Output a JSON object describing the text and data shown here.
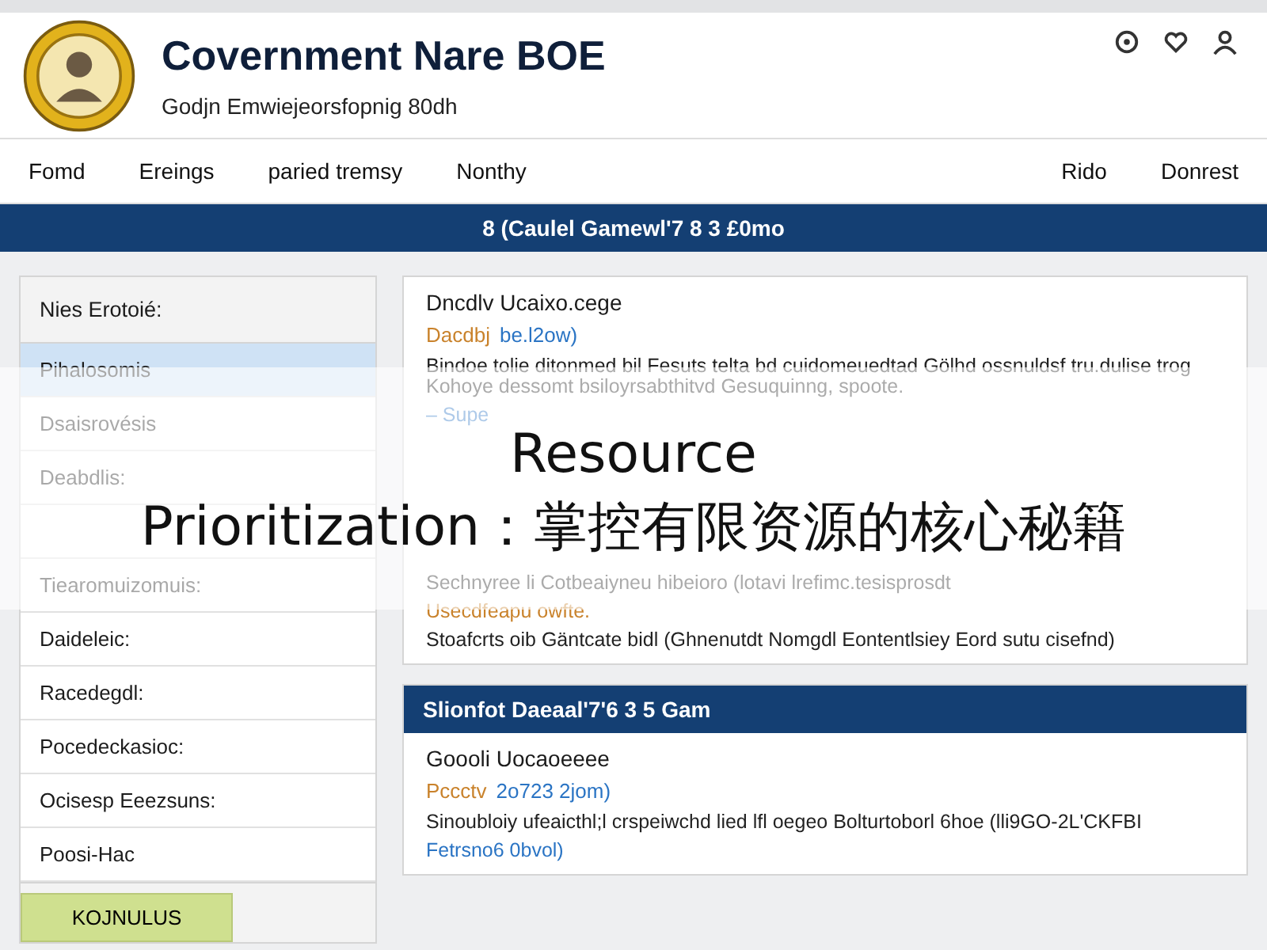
{
  "header": {
    "title": "Covernment Nare BOE",
    "subtitle": "Godjn Emwiejeorsfopnig 80dh"
  },
  "nav": {
    "left": [
      "Fomd",
      "Ereings",
      "paried tremsy",
      "Nonthy"
    ],
    "right": [
      "Rido",
      "Donrest"
    ]
  },
  "banner": "8 (Caulel Gamewl'7 8 3 £0mo",
  "sidebar": {
    "heading": "Nies Erotoié:",
    "items": [
      {
        "label": "Pihalosomis",
        "selected": true
      },
      {
        "label": "Dsaisrovésis",
        "selected": false
      },
      {
        "label": "Deabdlis:",
        "selected": false
      },
      {
        "selected": false
      },
      {
        "label": "Tiearomuizomuis:",
        "selected": false
      },
      {
        "label": "Daideleic:",
        "selected": false
      },
      {
        "label": "Racedegdl:",
        "selected": false
      },
      {
        "label": "Pocedeckasioc:",
        "selected": false
      },
      {
        "label": "Ocisesp Eeezsuns:",
        "selected": false
      },
      {
        "label": "Poosi-Hac",
        "selected": false
      }
    ],
    "button": "KOJNULUS"
  },
  "articles": [
    {
      "title": "Dncdlv Ucaixo.cege",
      "meta": [
        {
          "kind": "note",
          "text": "Dacdbj"
        },
        {
          "kind": "link",
          "text": "be.l2ow)"
        }
      ],
      "sections": [
        [
          {
            "kind": "text",
            "text": "Bindoe tolie ditonmed bil Fesuts telta bd cuidomeuedtad Gölhd ossnuldsf tru.dulise trog Kohoye dessomt bsiloyrsabthitvd Gesuquinng, spoote."
          },
          {
            "kind": "link",
            "text": "– Supe"
          }
        ],
        [
          {
            "kind": "text",
            "text": "Sechnyree li Cotbeaiyneu hibeioro (lotavi lrefimc.tesisprosdt"
          },
          {
            "kind": "note",
            "text": "Usecdfeapu owfte."
          },
          {
            "kind": "text",
            "text": "Stoafcrts oib Gäntcate bidl (Ghnenutdt Nomgdl Eontentlsiey Eord sutu cisefnd)"
          }
        ]
      ]
    },
    {
      "heading": "Slionfot Daeaal'7'6 3 5 Gam",
      "title": "Goooli Uocaoeeee",
      "meta": [
        {
          "kind": "note",
          "text": "Pccctv"
        },
        {
          "kind": "link",
          "text": "2o723 2jom)"
        }
      ],
      "sections": [
        [
          {
            "kind": "text",
            "text": "Sinoubloiy ufeaicthl;l crspeiwchd lied lfl oegeo Bolturtoborl 6hoe (lli9GO-2L'CKFBI"
          },
          {
            "kind": "link",
            "text": "Fetrsno6 0bvol)"
          }
        ]
      ]
    }
  ],
  "caption": {
    "lines": [
      "Resource",
      "Prioritization：掌控有限资源的核心秘籍"
    ]
  }
}
